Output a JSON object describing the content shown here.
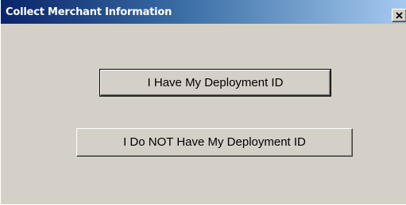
{
  "window": {
    "title": "Collect Merchant Information",
    "close_label": "×"
  },
  "buttons": {
    "have_id": "I Have My Deployment ID",
    "no_id": "I Do NOT Have My Deployment ID"
  },
  "icons": {
    "close": "close-icon"
  },
  "colors": {
    "titlebar_start": "#0a246a",
    "titlebar_end": "#a6caf0",
    "face": "#d4d0c8"
  }
}
